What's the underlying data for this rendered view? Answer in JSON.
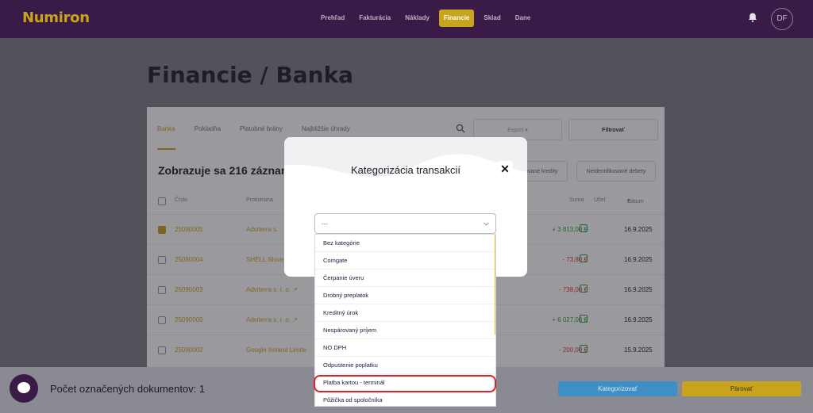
{
  "app": {
    "name": "Numiron"
  },
  "nav": {
    "items": [
      "Prehľad",
      "Fakturácia",
      "Náklady",
      "Financie",
      "Sklad",
      "Dane"
    ],
    "active": "Financie"
  },
  "user": {
    "initials": "DF"
  },
  "page": {
    "title": "Financie / Banka"
  },
  "tabs": [
    "Banka",
    "Pokladňa",
    "Platobné brány",
    "Najbližšie úhrady"
  ],
  "toolbar": {
    "export_label": "Export",
    "filter_label": "Filtrovať"
  },
  "records": {
    "count_text": "Zobrazuje sa 216 záznamov",
    "pill_credits": "kované kredity",
    "pill_debits": "Neidentifikované debety"
  },
  "table": {
    "headers": {
      "number": "Číslo",
      "partner": "Protistrana",
      "amount": "Suma",
      "account": "Účet",
      "date": "Dátum"
    },
    "rows": [
      {
        "number": "25090005",
        "partner": "Adviterra s.",
        "amount": "+ 3 813,00 €",
        "date": "16.9.2025",
        "checked": true
      },
      {
        "number": "25090004",
        "partner": "SHELL Slove",
        "amount": "- 73,80 €",
        "date": "16.9.2025",
        "checked": false
      },
      {
        "number": "25090003",
        "partner": "Adviterra s. r. o.",
        "amount": "- 738,00 €",
        "date": "16.9.2025",
        "checked": false
      },
      {
        "number": "25090000",
        "partner": "Adviterra s. r. o.",
        "amount": "+ 6 027,00 €",
        "date": "16.9.2025",
        "checked": false
      },
      {
        "number": "25090002",
        "partner": "Google Ireland Limite",
        "amount": "- 200,00 €",
        "date": "15.9.2025",
        "checked": false
      }
    ]
  },
  "modal": {
    "title": "Kategorizácia transakcií",
    "close_label": "✕",
    "select_value": "---",
    "options": [
      "Bez kategórie",
      "Comgate",
      "Čerpanie úveru",
      "Drobný preplatok",
      "Kreditný úrok",
      "Nespárovaný príjem",
      "NO DPH",
      "Odpustenie poplatku",
      "Platba kartou - terminál",
      "Pôžička od spoločníka"
    ],
    "highlighted_option": "Platba kartou - terminál"
  },
  "bottom": {
    "selected_text": "Počet označených dokumentov: 1",
    "categorize_label": "Kategorizovať",
    "pair_label": "Párovať"
  },
  "colors": {
    "brand": "#3a1a46",
    "accent": "#c9a31c",
    "primary": "#3d8fc6",
    "highlight": "#e0202a"
  }
}
